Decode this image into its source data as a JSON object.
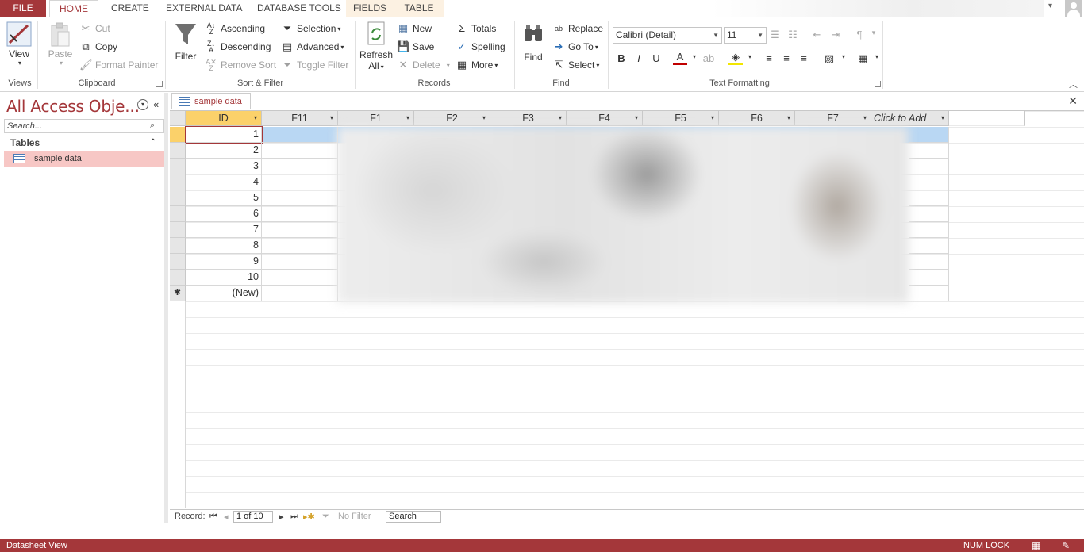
{
  "tabs": [
    "FILE",
    "HOME",
    "CREATE",
    "EXTERNAL DATA",
    "DATABASE TOOLS",
    "FIELDS",
    "TABLE"
  ],
  "ribbon": {
    "views": {
      "view": "View",
      "label": "Views"
    },
    "clipboard": {
      "paste": "Paste",
      "cut": "Cut",
      "copy": "Copy",
      "format_painter": "Format Painter",
      "label": "Clipboard"
    },
    "sort_filter": {
      "filter": "Filter",
      "ascending": "Ascending",
      "descending": "Descending",
      "remove_sort": "Remove Sort",
      "selection": "Selection",
      "advanced": "Advanced",
      "toggle_filter": "Toggle Filter",
      "label": "Sort & Filter"
    },
    "records": {
      "refresh": "Refresh",
      "refresh2": "All",
      "new": "New",
      "save": "Save",
      "delete": "Delete",
      "totals": "Totals",
      "spelling": "Spelling",
      "more": "More",
      "label": "Records"
    },
    "find": {
      "find": "Find",
      "replace": "Replace",
      "goto": "Go To",
      "select": "Select",
      "label": "Find"
    },
    "text_formatting": {
      "font": "Calibri (Detail)",
      "size": "11",
      "label": "Text Formatting",
      "bold": "B",
      "italic": "I",
      "underline": "U",
      "font_color": "A"
    }
  },
  "nav": {
    "title": "All Access Obje...",
    "search_placeholder": "Search...",
    "category": "Tables",
    "item": "sample data"
  },
  "doc": {
    "tab": "sample data",
    "columns": [
      "ID",
      "F11",
      "F1",
      "F2",
      "F3",
      "F4",
      "F5",
      "F6",
      "F7",
      "Click to Add"
    ],
    "ids": [
      "1",
      "2",
      "3",
      "4",
      "5",
      "6",
      "7",
      "8",
      "9",
      "10",
      "(New)"
    ]
  },
  "record_nav": {
    "label": "Record:",
    "position": "1 of 10",
    "no_filter": "No Filter",
    "search": "Search"
  },
  "status": {
    "view": "Datasheet View",
    "num_lock": "NUM LOCK"
  },
  "colors": {
    "accent": "#a4373a",
    "header_selected": "#fbd16a",
    "row_selected": "#b9d7f3"
  }
}
